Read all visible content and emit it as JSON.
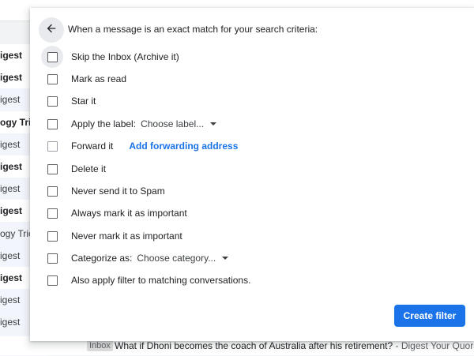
{
  "background": {
    "rows": [
      {
        "text": "igest",
        "style": "bold"
      },
      {
        "text": "igest",
        "style": "bold"
      },
      {
        "text": "igest",
        "style": "light"
      },
      {
        "text": "ogy Tricks",
        "style": "bold"
      },
      {
        "text": "igest",
        "style": "light"
      },
      {
        "text": "igest",
        "style": "bold"
      },
      {
        "text": "igest",
        "style": "light"
      },
      {
        "text": "igest",
        "style": "bold"
      },
      {
        "text": "ogy Tricks",
        "style": "light"
      },
      {
        "text": "igest",
        "style": "light"
      },
      {
        "text": "igest",
        "style": "bold"
      },
      {
        "text": "igest",
        "style": "light"
      },
      {
        "text": "igest",
        "style": "light"
      },
      {
        "text": "igest",
        "style": "light"
      }
    ],
    "bottom_email": {
      "badge": "Inbox",
      "subject": "What if Dhoni becomes the coach of Australia after his retirement?",
      "snippet": " - Digest Your Quora Dig"
    }
  },
  "dialog": {
    "header": "When a message is an exact match for your search criteria:",
    "options": {
      "skip_inbox": "Skip the Inbox (Archive it)",
      "mark_read": "Mark as read",
      "star": "Star it",
      "apply_label": "Apply the label:",
      "label_dropdown": "Choose label...",
      "forward": "Forward it",
      "forward_link": "Add forwarding address",
      "delete": "Delete it",
      "never_spam": "Never send it to Spam",
      "always_important": "Always mark it as important",
      "never_important": "Never mark it as important",
      "categorize": "Categorize as:",
      "category_dropdown": "Choose category...",
      "apply_matching": "Also apply filter to matching conversations."
    },
    "create_button": "Create filter"
  },
  "colors": {
    "accent": "#1a73e8",
    "text": "#202124"
  }
}
